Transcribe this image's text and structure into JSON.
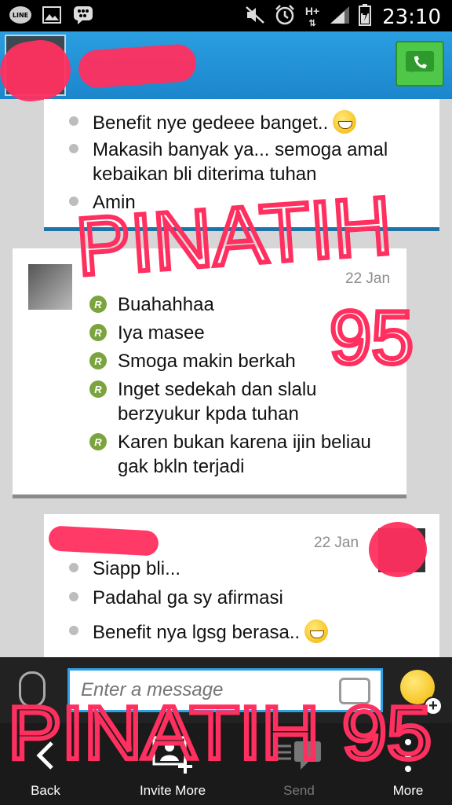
{
  "status_bar": {
    "icons": [
      "line-icon",
      "gallery-icon",
      "bbm-icon",
      "mute-icon",
      "alarm-icon",
      "hplus-icon",
      "signal-icon",
      "battery-icon"
    ],
    "line_label": "LINE",
    "network": "H+",
    "time": "23:10"
  },
  "header": {
    "call_icon": "phone-icon"
  },
  "messages": [
    {
      "side": "mine",
      "items": [
        {
          "text": "Benefit nye gedeee banget..",
          "emoji": "grin"
        },
        {
          "text": "Makasih banyak ya... semoga amal kebaikan bli diterima tuhan"
        },
        {
          "text": "Amin"
        }
      ]
    },
    {
      "side": "theirs",
      "time": "22 Jan",
      "items": [
        {
          "text": "Buahahhaa",
          "badge": "R"
        },
        {
          "text": "Iya masee",
          "badge": "R"
        },
        {
          "text": "Smoga makin berkah",
          "badge": "R"
        },
        {
          "text": "Inget sedekah dan slalu berzyukur kpda tuhan",
          "badge": "R"
        },
        {
          "text": "Karen bukan karena ijin beliau gak bkln terjadi",
          "badge": "R"
        }
      ]
    },
    {
      "side": "mine",
      "time": "22 Jan",
      "items": [
        {
          "text": "Siapp bli..."
        },
        {
          "text": "Padahal ga sy afirmasi"
        },
        {
          "text": "Benefit nya lgsg berasa..",
          "emoji": "grin"
        }
      ]
    }
  ],
  "input": {
    "placeholder": "Enter a message"
  },
  "actions": [
    {
      "label": "Back",
      "icon": "back-icon",
      "enabled": true
    },
    {
      "label": "Invite More",
      "icon": "invite-icon",
      "enabled": true
    },
    {
      "label": "Send",
      "icon": "send-icon",
      "enabled": false
    },
    {
      "label": "More",
      "icon": "more-icon",
      "enabled": true
    }
  ],
  "watermark": {
    "text_top_1": "PINATIH",
    "text_top_2": "95",
    "text_bottom": "PINATIH 95"
  },
  "colors": {
    "header_blue": "#1c86cc",
    "accent_blue": "#2ea2e6",
    "read_badge": "#7ba43f",
    "redact_pink": "#ff2f5f"
  }
}
